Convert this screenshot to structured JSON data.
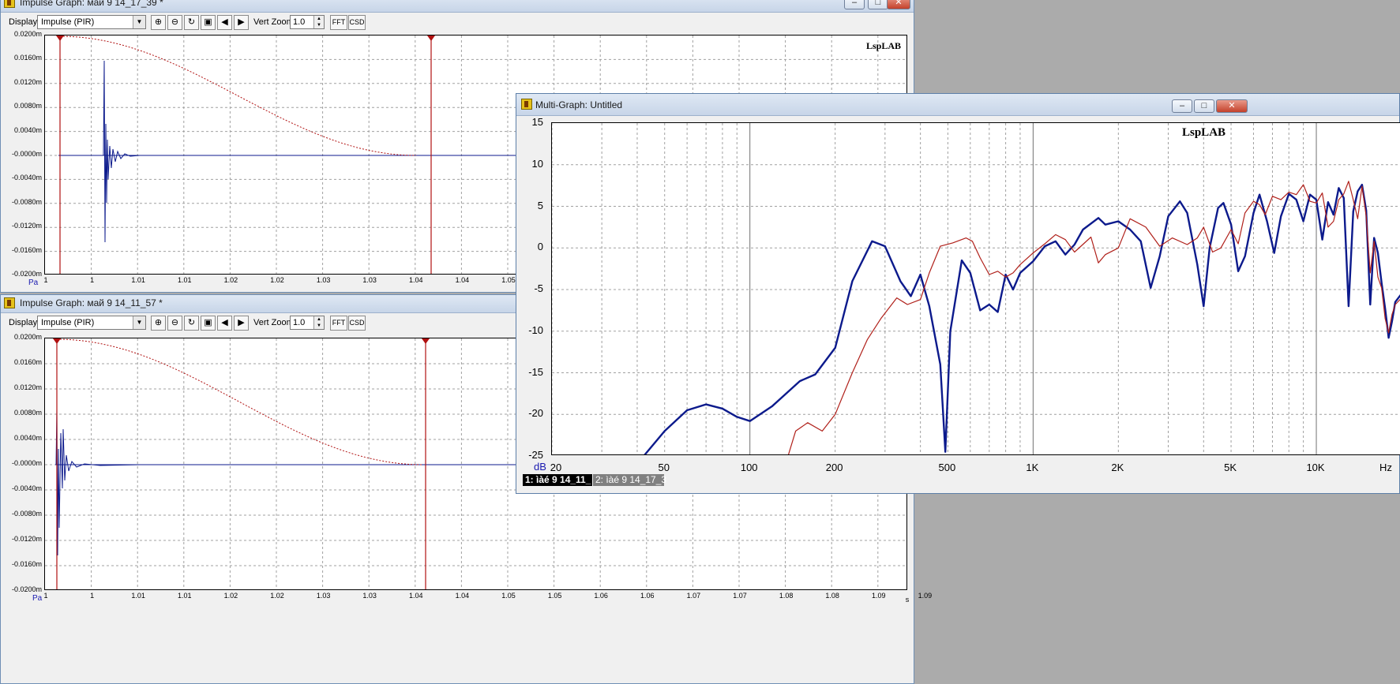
{
  "window1": {
    "title": "Impulse Graph: май 9 14_17_39 *",
    "display_label": "Display",
    "display_value": "Impulse (PIR)",
    "vert_zoom_label": "Vert Zoom",
    "vert_zoom_value": "1.0",
    "fft_label": "FFT",
    "csd_label": "CSD",
    "brand": "LspLAB",
    "y_ticks": [
      "0.0200m",
      "0.0160m",
      "0.0120m",
      "0.0080m",
      "0.0040m",
      "-0.0000m",
      "-0.0040m",
      "-0.0080m",
      "-0.0120m",
      "-0.0160m",
      "-0.0200m"
    ],
    "x_ticks": [
      "1",
      "1",
      "1.01",
      "1.01",
      "1.02",
      "1.02",
      "1.03",
      "1.03",
      "1.04",
      "1.04",
      "1.05"
    ],
    "y_unit": "Pa"
  },
  "window2": {
    "title": "Impulse Graph: май 9 14_11_57 *",
    "display_label": "Display",
    "display_value": "Impulse (PIR)",
    "vert_zoom_label": "Vert Zoom",
    "vert_zoom_value": "1.0",
    "fft_label": "FFT",
    "csd_label": "CSD",
    "y_ticks": [
      "0.0200m",
      "0.0160m",
      "0.0120m",
      "0.0080m",
      "0.0040m",
      "-0.0000m",
      "-0.0040m",
      "-0.0080m",
      "-0.0120m",
      "-0.0160m",
      "-0.0200m"
    ],
    "x_ticks": [
      "1",
      "1",
      "1.01",
      "1.01",
      "1.02",
      "1.02",
      "1.03",
      "1.03",
      "1.04",
      "1.04",
      "1.05",
      "1.05",
      "1.06",
      "1.06",
      "1.07",
      "1.07",
      "1.08",
      "1.08",
      "1.09",
      "1.09"
    ],
    "y_unit": "Pa",
    "x_unit": "s"
  },
  "window3": {
    "title": "Multi-Graph: Untitled",
    "brand": "LspLAB",
    "y_unit": "dB",
    "x_unit": "Hz",
    "legend": [
      "1: ìàé 9 14_11_",
      "2: ìàé 9 14_17_3"
    ]
  },
  "colors": {
    "trace_blue": "#0c1a8c",
    "trace_red": "#b0201a",
    "marker_red": "#b01010",
    "grid": "#a0a0a0"
  },
  "chart_data": {
    "type": "line",
    "xscale": "log",
    "xlim": [
      20,
      20000
    ],
    "ylim": [
      -25,
      15
    ],
    "x_ticks": [
      20,
      50,
      100,
      200,
      500,
      1000,
      2000,
      5000,
      10000
    ],
    "x_tick_labels": [
      "20",
      "50",
      "100",
      "200",
      "500",
      "1K",
      "2K",
      "5K",
      "10K"
    ],
    "y_ticks": [
      15,
      10,
      5,
      0,
      -5,
      -10,
      -15,
      -20,
      -25
    ],
    "xlabel": "Hz",
    "ylabel": "dB",
    "series": [
      {
        "name": "1: ìàé 9 14_11_",
        "color": "#0c1a8c",
        "points": [
          [
            41,
            -25.5
          ],
          [
            50,
            -22
          ],
          [
            60,
            -19.5
          ],
          [
            70,
            -18.8
          ],
          [
            80,
            -19.3
          ],
          [
            90,
            -20.3
          ],
          [
            100,
            -20.8
          ],
          [
            120,
            -19
          ],
          [
            150,
            -16
          ],
          [
            170,
            -15.2
          ],
          [
            200,
            -12
          ],
          [
            230,
            -4
          ],
          [
            270,
            0.8
          ],
          [
            300,
            0.2
          ],
          [
            340,
            -4
          ],
          [
            370,
            -5.8
          ],
          [
            400,
            -3.2
          ],
          [
            430,
            -7
          ],
          [
            470,
            -14
          ],
          [
            490,
            -24.5
          ],
          [
            510,
            -10
          ],
          [
            560,
            -1.5
          ],
          [
            600,
            -3
          ],
          [
            650,
            -7.5
          ],
          [
            700,
            -6.8
          ],
          [
            750,
            -7.7
          ],
          [
            800,
            -3.2
          ],
          [
            850,
            -5
          ],
          [
            900,
            -3
          ],
          [
            1000,
            -1.6
          ],
          [
            1100,
            0.2
          ],
          [
            1200,
            0.8
          ],
          [
            1300,
            -0.8
          ],
          [
            1400,
            0.4
          ],
          [
            1500,
            2.2
          ],
          [
            1700,
            3.6
          ],
          [
            1800,
            2.8
          ],
          [
            2000,
            3.2
          ],
          [
            2200,
            2.2
          ],
          [
            2400,
            0.8
          ],
          [
            2600,
            -4.8
          ],
          [
            2800,
            -1
          ],
          [
            3000,
            3.8
          ],
          [
            3300,
            5.6
          ],
          [
            3500,
            4.2
          ],
          [
            3800,
            -2
          ],
          [
            4000,
            -7
          ],
          [
            4200,
            0
          ],
          [
            4500,
            4.8
          ],
          [
            4700,
            5.4
          ],
          [
            5000,
            2.8
          ],
          [
            5300,
            -2.8
          ],
          [
            5600,
            -1
          ],
          [
            6000,
            4.2
          ],
          [
            6300,
            6.4
          ],
          [
            6700,
            3.2
          ],
          [
            7100,
            -0.6
          ],
          [
            7500,
            3.8
          ],
          [
            8000,
            6.5
          ],
          [
            8500,
            5.8
          ],
          [
            9000,
            3.2
          ],
          [
            9500,
            6.4
          ],
          [
            10000,
            5.8
          ],
          [
            10500,
            1
          ],
          [
            11000,
            5.5
          ],
          [
            11500,
            4
          ],
          [
            12000,
            7.2
          ],
          [
            12500,
            6
          ],
          [
            13000,
            -7
          ],
          [
            13500,
            4.4
          ],
          [
            14000,
            6.8
          ],
          [
            14500,
            7.6
          ],
          [
            15000,
            4.5
          ],
          [
            15500,
            -6.8
          ],
          [
            16000,
            1.2
          ],
          [
            16500,
            -0.6
          ],
          [
            17000,
            -4.2
          ],
          [
            17500,
            -7.3
          ],
          [
            18000,
            -10.8
          ],
          [
            18500,
            -8.8
          ],
          [
            19000,
            -6.5
          ],
          [
            20000,
            -5.5
          ]
        ]
      },
      {
        "name": "2: ìàé 9 14_17_3",
        "color": "#b0201a",
        "points": [
          [
            135,
            -25.5
          ],
          [
            145,
            -22
          ],
          [
            160,
            -21
          ],
          [
            180,
            -22
          ],
          [
            200,
            -20
          ],
          [
            230,
            -15
          ],
          [
            260,
            -11
          ],
          [
            290,
            -8.5
          ],
          [
            330,
            -6
          ],
          [
            360,
            -6.8
          ],
          [
            400,
            -6.2
          ],
          [
            430,
            -3
          ],
          [
            470,
            0.2
          ],
          [
            520,
            0.6
          ],
          [
            580,
            1.2
          ],
          [
            610,
            0.8
          ],
          [
            650,
            -1.2
          ],
          [
            700,
            -3.2
          ],
          [
            750,
            -2.8
          ],
          [
            800,
            -3.5
          ],
          [
            850,
            -3
          ],
          [
            900,
            -2
          ],
          [
            1000,
            -0.6
          ],
          [
            1100,
            0.5
          ],
          [
            1200,
            1.6
          ],
          [
            1300,
            1
          ],
          [
            1400,
            -0.5
          ],
          [
            1600,
            1.3
          ],
          [
            1700,
            -1.8
          ],
          [
            1800,
            -0.8
          ],
          [
            2000,
            0
          ],
          [
            2200,
            3.5
          ],
          [
            2500,
            2.5
          ],
          [
            2800,
            0.2
          ],
          [
            3100,
            1.2
          ],
          [
            3500,
            0.4
          ],
          [
            3800,
            1.2
          ],
          [
            4000,
            2.5
          ],
          [
            4300,
            -0.5
          ],
          [
            4600,
            0
          ],
          [
            5000,
            2.2
          ],
          [
            5300,
            0.5
          ],
          [
            5600,
            4.2
          ],
          [
            6000,
            5.6
          ],
          [
            6300,
            5.2
          ],
          [
            6600,
            4
          ],
          [
            7000,
            6.2
          ],
          [
            7500,
            5.8
          ],
          [
            8000,
            6.7
          ],
          [
            8500,
            6.4
          ],
          [
            9000,
            7.6
          ],
          [
            9500,
            5.6
          ],
          [
            10000,
            5.4
          ],
          [
            10500,
            6.6
          ],
          [
            11000,
            2.5
          ],
          [
            11500,
            3.2
          ],
          [
            12000,
            5.8
          ],
          [
            12500,
            6.5
          ],
          [
            13000,
            8
          ],
          [
            13500,
            5.8
          ],
          [
            14000,
            3.5
          ],
          [
            14500,
            7.4
          ],
          [
            15000,
            3.8
          ],
          [
            15500,
            -3
          ],
          [
            16000,
            0.8
          ],
          [
            16500,
            -3.5
          ],
          [
            17000,
            -4.8
          ],
          [
            17500,
            -8.5
          ],
          [
            18000,
            -10.2
          ],
          [
            18500,
            -8
          ],
          [
            19000,
            -6.8
          ],
          [
            20000,
            -6
          ]
        ]
      }
    ]
  }
}
